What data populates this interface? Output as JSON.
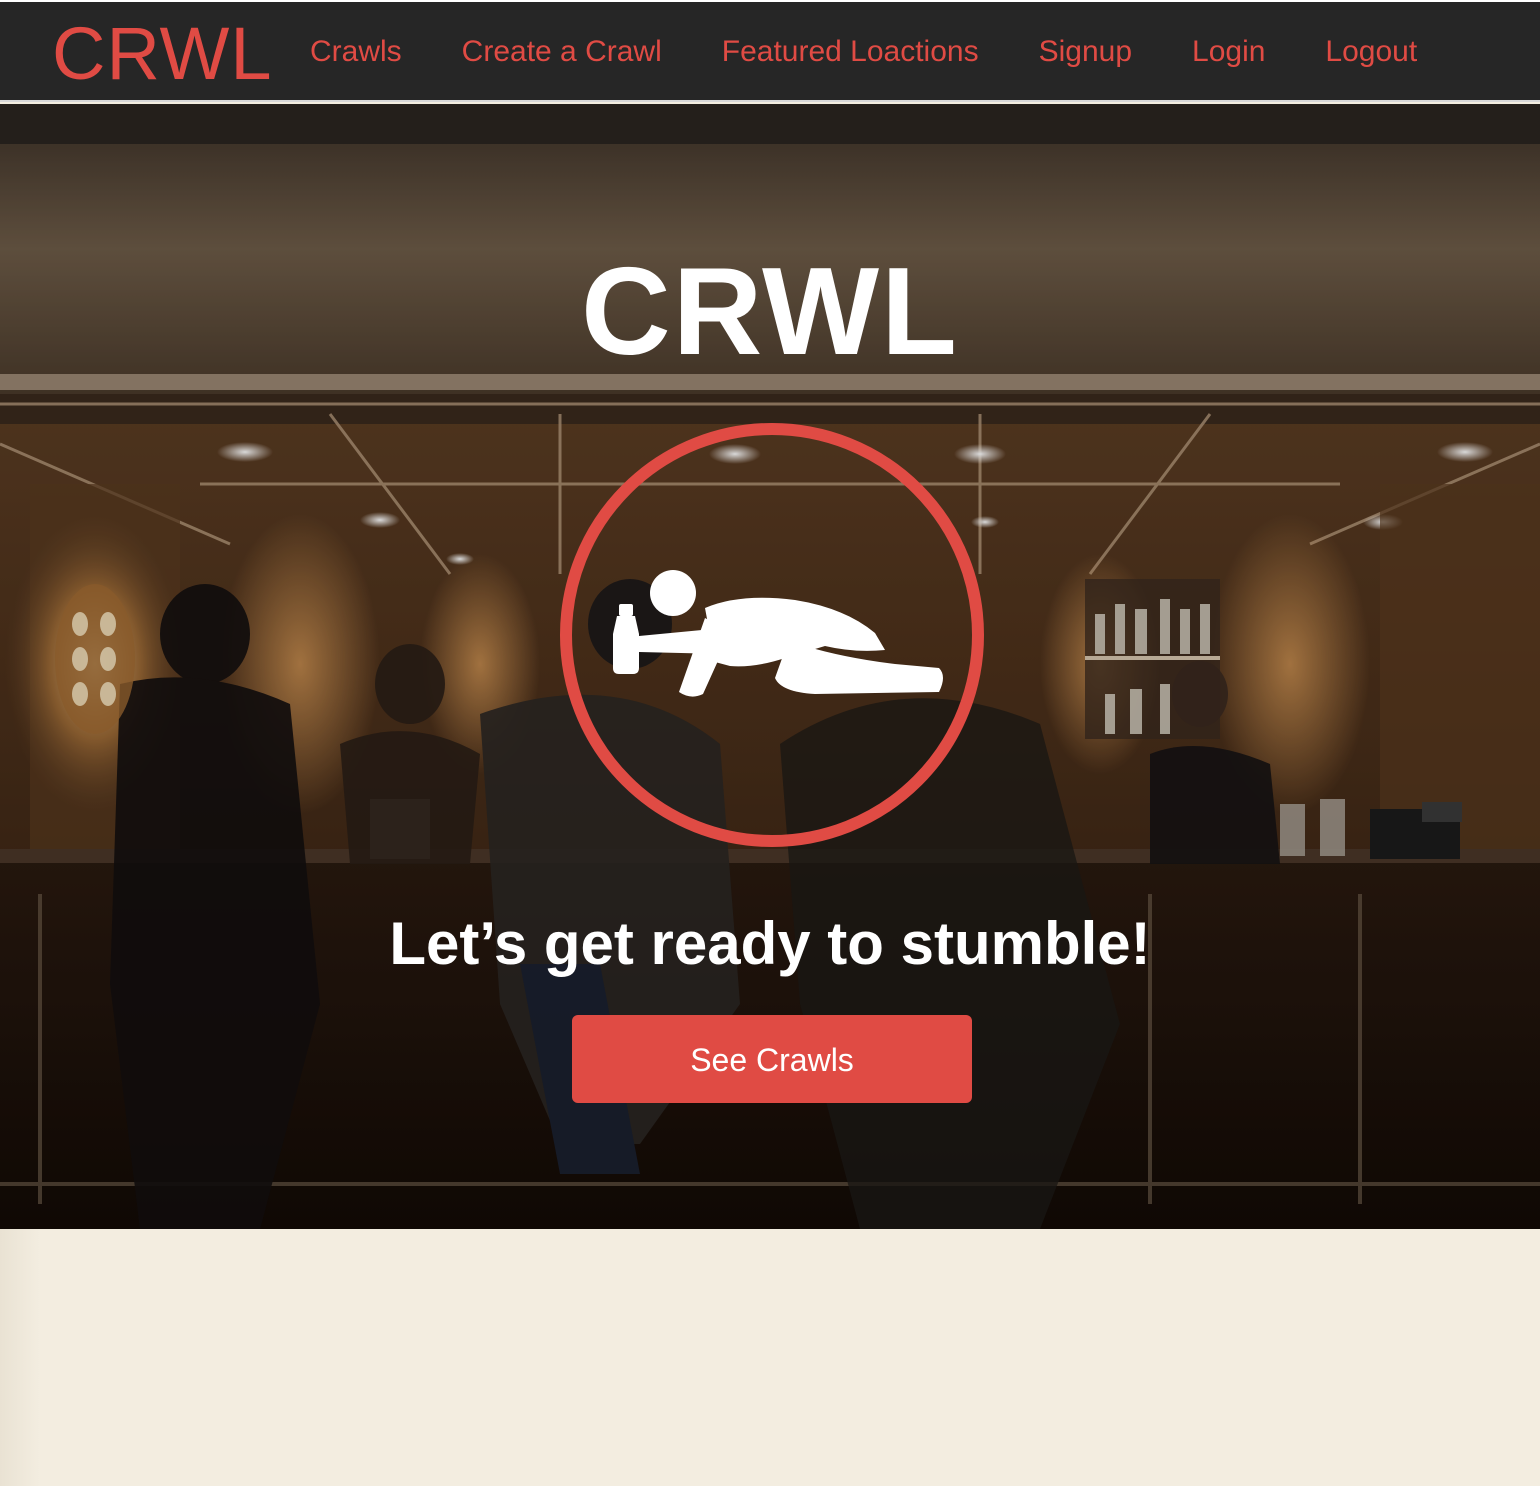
{
  "navbar": {
    "brand": "CRWL",
    "links": [
      {
        "label": "Crawls"
      },
      {
        "label": "Create a Crawl"
      },
      {
        "label": "Featured Loactions"
      },
      {
        "label": "Signup"
      },
      {
        "label": "Login"
      },
      {
        "label": "Logout"
      }
    ]
  },
  "hero": {
    "title": "CRWL",
    "logo_icon": "crawling-person-with-bottle-icon",
    "background": "bar-interior-photo",
    "tagline": "Let’s get ready to stumble!",
    "cta_label": "See Crawls"
  },
  "colors": {
    "accent": "#e04b44",
    "navbar_bg": "#262626",
    "page_bg": "#f3ede0",
    "text_light": "#ffffff"
  }
}
